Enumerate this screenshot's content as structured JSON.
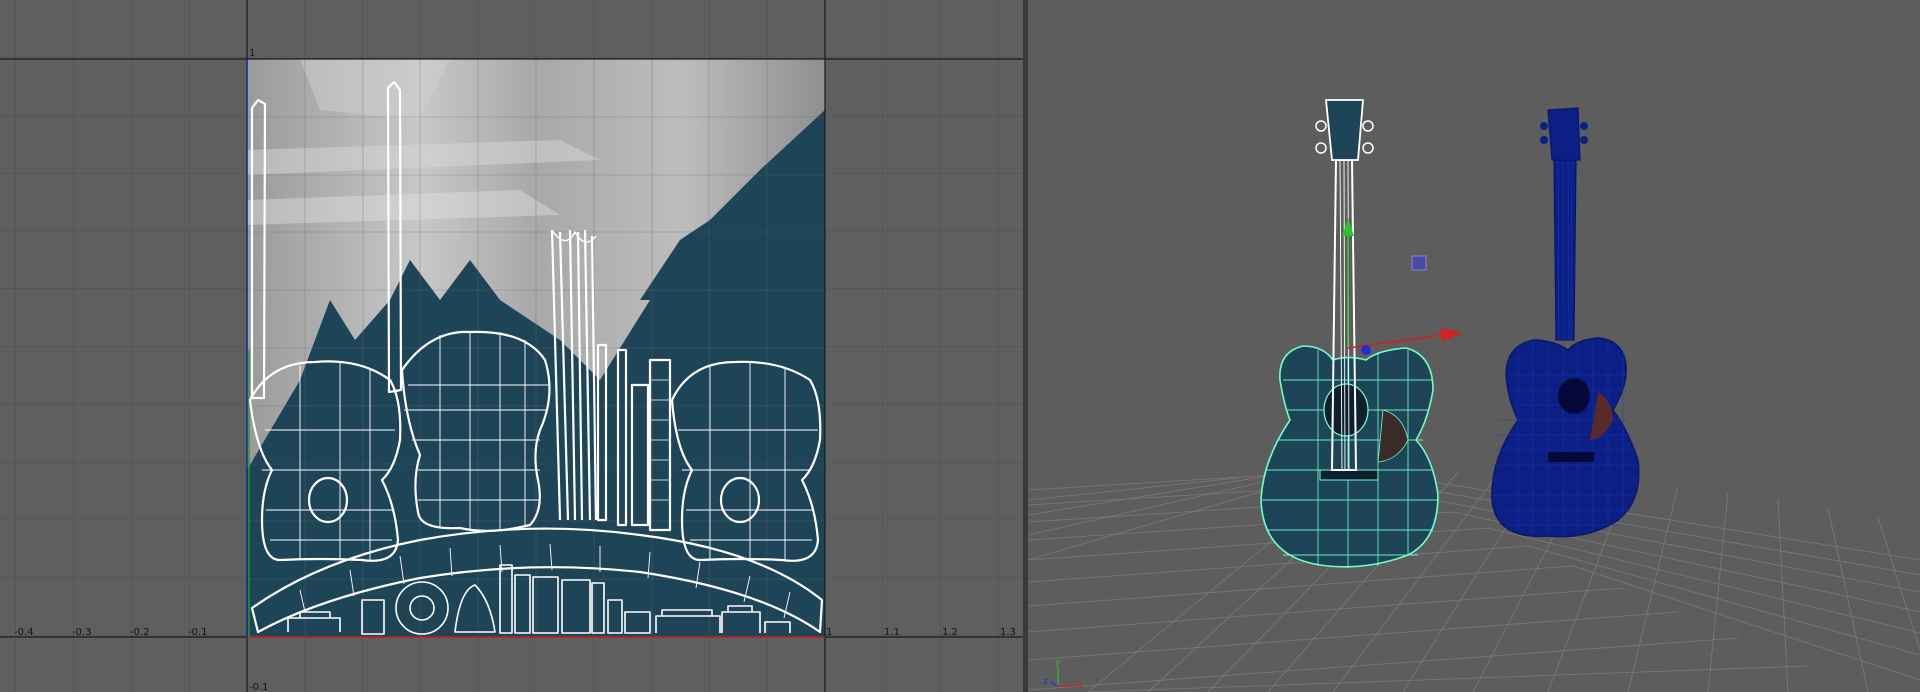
{
  "uv_editor": {
    "top_label": "1",
    "bottom_label": "-0.1",
    "axis_labels": [
      "-0.4",
      "-0.3",
      "-0.2",
      "-0.1",
      "1",
      "1.1",
      "1.2",
      "1.3"
    ]
  },
  "perspective": {
    "axis_gizmo": {
      "x": "x",
      "y": "y",
      "z": "z"
    }
  },
  "colors": {
    "uv_fill": "#1e4458",
    "wire": "#ffffff",
    "selected_wire": "#6effc8",
    "unselected_mesh": "#0b1f84",
    "uv_bg": "#5f5f5f",
    "grid": "#4e4e4e"
  }
}
